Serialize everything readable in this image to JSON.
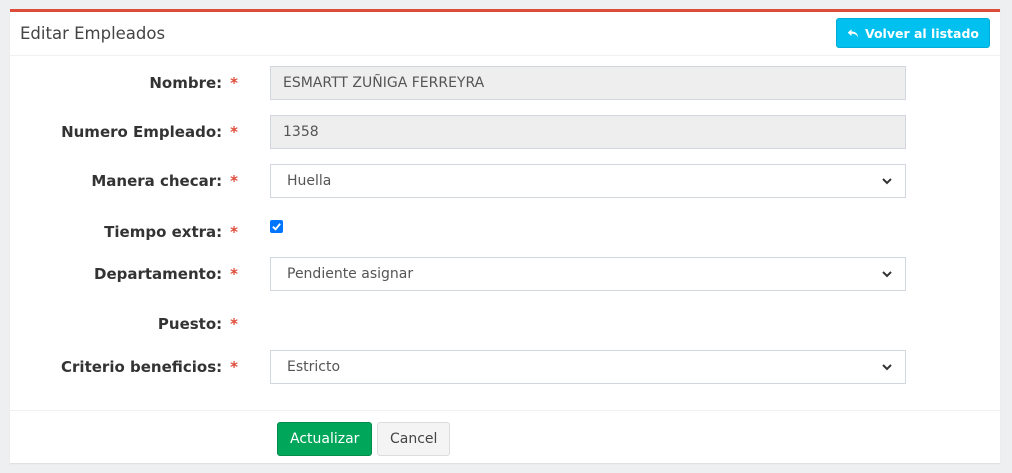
{
  "header": {
    "title": "Editar Empleados",
    "back_label": "Volver al listado"
  },
  "required_mark": "*",
  "fields": {
    "nombre": {
      "label": "Nombre:",
      "value": "ESMARTT ZUÑIGA FERREYRA"
    },
    "numero": {
      "label": "Numero Empleado:",
      "value": "1358"
    },
    "manera": {
      "label": "Manera checar:",
      "value": "Huella"
    },
    "tiempo": {
      "label": "Tiempo extra:",
      "checked": true
    },
    "departamento": {
      "label": "Departamento:",
      "value": "Pendiente asignar"
    },
    "puesto": {
      "label": "Puesto:"
    },
    "criterio": {
      "label": "Criterio beneficios:",
      "value": "Estricto"
    }
  },
  "footer": {
    "save_label": "Actualizar",
    "cancel_label": "Cancel"
  },
  "colors": {
    "accent_border": "#dd4b39",
    "info_button": "#00c0ef",
    "success_button": "#00a65a",
    "required": "#dd4b39"
  },
  "icons": {
    "back": "reply-icon",
    "select": "chevron-down-icon",
    "checkbox": "checkmark-icon"
  }
}
